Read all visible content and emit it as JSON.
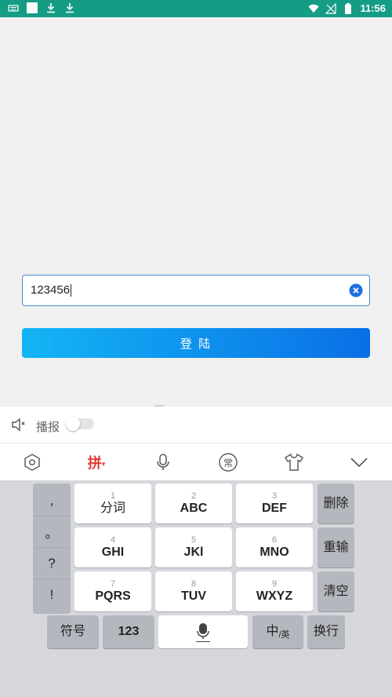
{
  "status_bar": {
    "time": "11:56"
  },
  "login": {
    "input_value": "123456",
    "button_label": "登 陆"
  },
  "broadcast": {
    "label": "播报"
  },
  "toolbar": {
    "pinyin_label": "拼",
    "common_label": "常"
  },
  "keyboard": {
    "punct": [
      ",",
      "。",
      "?",
      "!"
    ],
    "keys": [
      {
        "num": "1",
        "label": "分词"
      },
      {
        "num": "2",
        "label": "ABC"
      },
      {
        "num": "3",
        "label": "DEF"
      },
      {
        "num": "4",
        "label": "GHI"
      },
      {
        "num": "5",
        "label": "JKl"
      },
      {
        "num": "6",
        "label": "MNO"
      },
      {
        "num": "7",
        "label": "PQRS"
      },
      {
        "num": "8",
        "label": "TUV"
      },
      {
        "num": "9",
        "label": "WXYZ"
      }
    ],
    "side": [
      "删除",
      "重输",
      "清空"
    ],
    "bottom": {
      "symbol": "符号",
      "numbers": "123",
      "lang_main": "中",
      "lang_sub": "/英",
      "newline": "换行"
    }
  }
}
